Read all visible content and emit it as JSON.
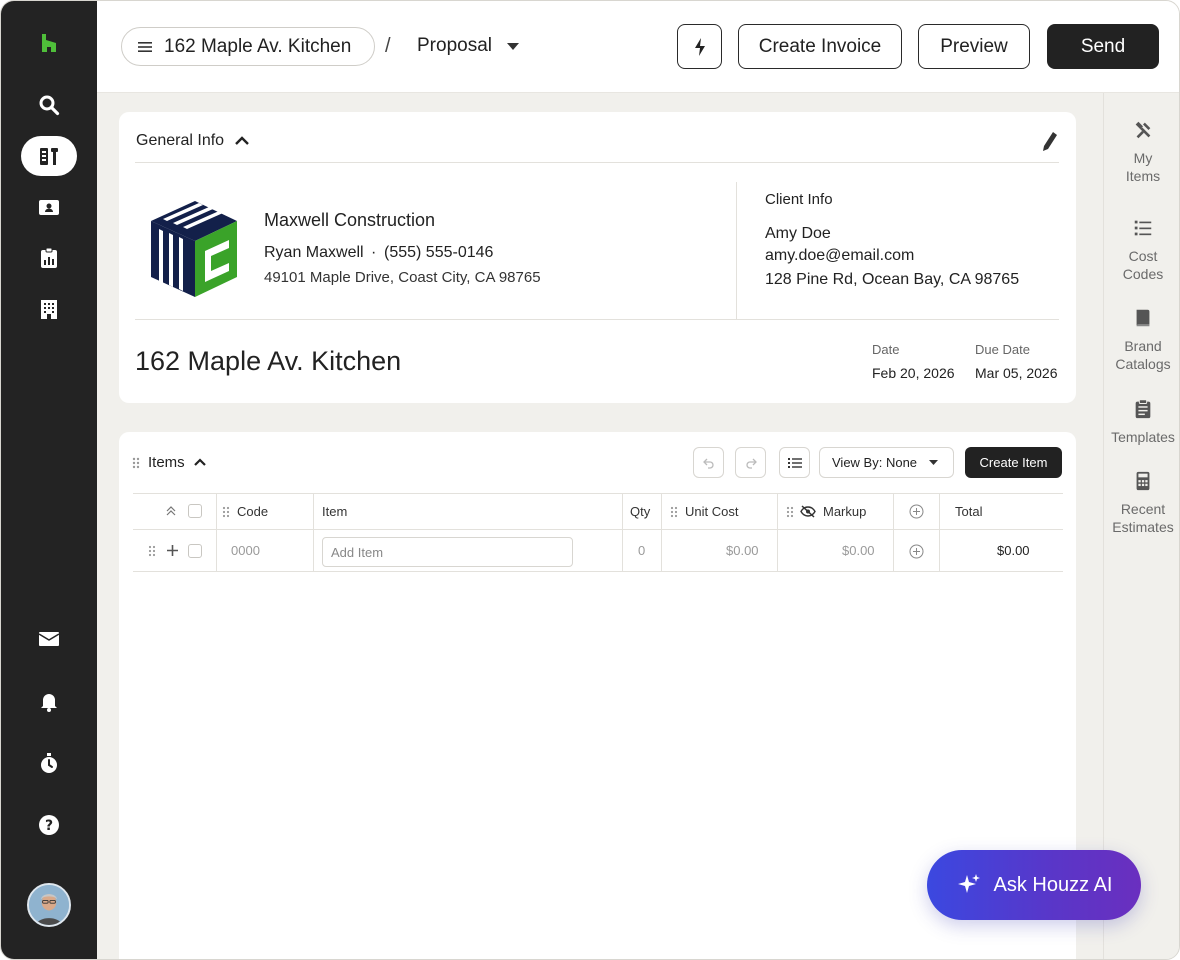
{
  "app": {
    "brand_color": "#4fbf3a",
    "accent_color": "#222222"
  },
  "topbar": {
    "project_name": "162 Maple Av. Kitchen",
    "separator": "/",
    "doc_type": "Proposal",
    "create_invoice_label": "Create Invoice",
    "preview_label": "Preview",
    "send_label": "Send"
  },
  "leftnav": {
    "items": [
      "houzz-logo-icon",
      "search-icon",
      "tools-icon",
      "contact-card-icon",
      "report-icon",
      "building-icon",
      "mail-icon",
      "bell-icon",
      "timer-icon",
      "help-icon"
    ]
  },
  "rightrail": {
    "items": [
      {
        "label_line1": "My",
        "label_line2": "Items",
        "icon": "tools-icon"
      },
      {
        "label_line1": "Cost",
        "label_line2": "Codes",
        "icon": "list-icon"
      },
      {
        "label_line1": "Brand",
        "label_line2": "Catalogs",
        "icon": "book-icon"
      },
      {
        "label_line1": "Templates",
        "label_line2": "",
        "icon": "clipboard-icon"
      },
      {
        "label_line1": "Recent",
        "label_line2": "Estimates",
        "icon": "calculator-icon"
      }
    ]
  },
  "general_info": {
    "header": "General Info",
    "company": {
      "name": "Maxwell Construction",
      "contact_name": "Ryan Maxwell",
      "dot": "·",
      "phone": "(555) 555-0146",
      "address": "49101 Maple Drive, Coast City, CA 98765"
    },
    "client": {
      "header": "Client Info",
      "name": "Amy Doe",
      "email": "amy.doe@email.com",
      "address": "128 Pine Rd, Ocean Bay, CA 98765"
    },
    "project_title": "162 Maple Av. Kitchen",
    "date_label": "Date",
    "date_value": "Feb 20, 2026",
    "due_label": "Due Date",
    "due_value": "Mar 05, 2026"
  },
  "items": {
    "header": "Items",
    "view_by_label": "View By: None",
    "create_item_label": "Create Item",
    "columns": {
      "code": "Code",
      "item": "Item",
      "qty": "Qty",
      "unit_cost": "Unit Cost",
      "markup": "Markup",
      "total": "Total"
    },
    "rows": [
      {
        "code": "0000",
        "item_placeholder": "Add Item",
        "qty": "0",
        "unit_cost": "$0.00",
        "markup": "$0.00",
        "total": "$0.00"
      }
    ]
  },
  "ai": {
    "label": "Ask Houzz AI"
  }
}
